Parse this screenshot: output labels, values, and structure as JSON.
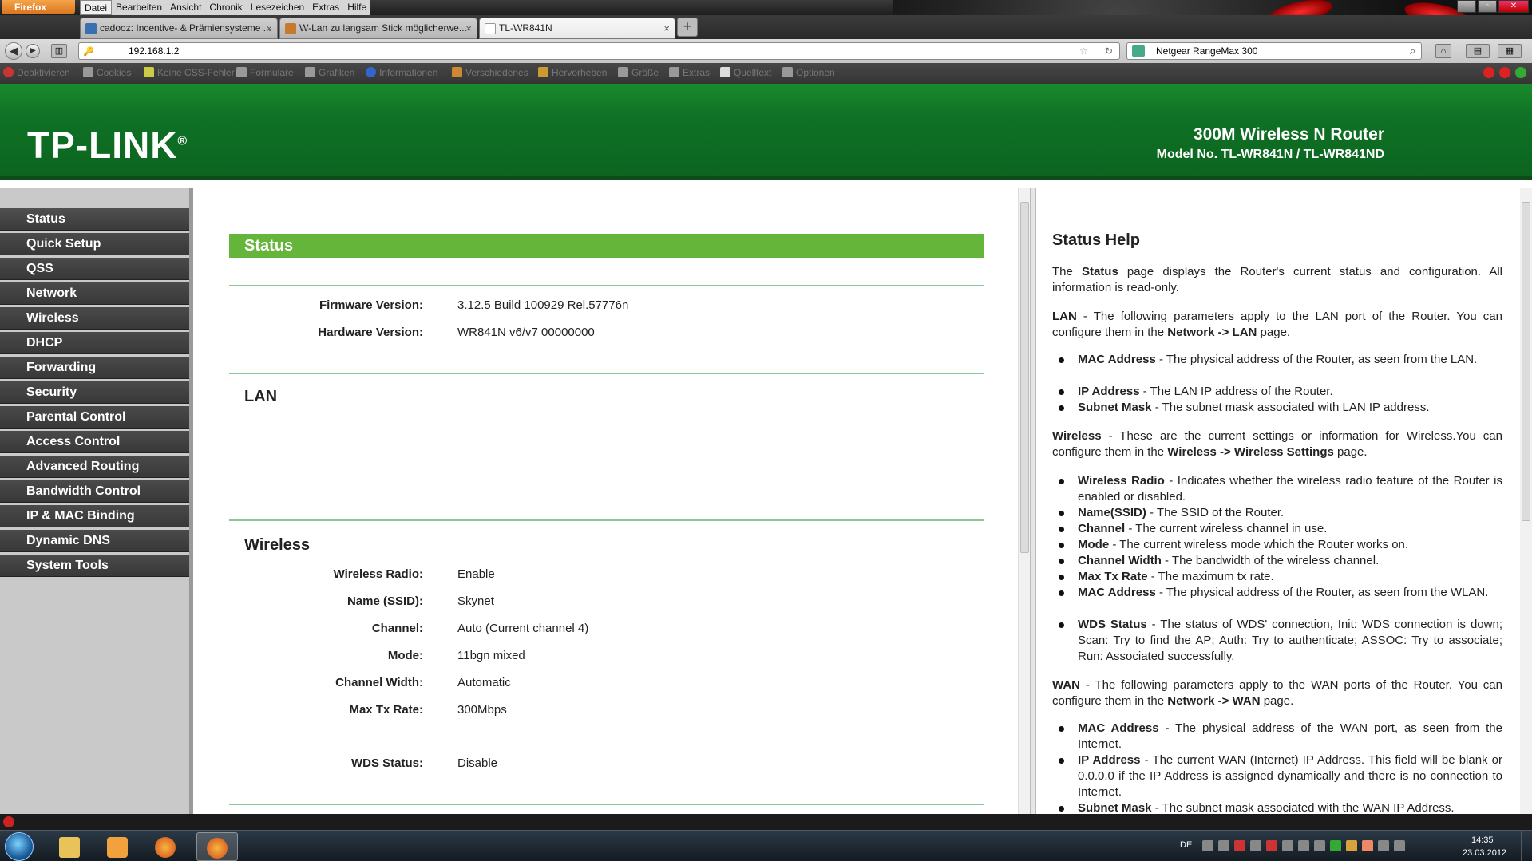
{
  "browser": {
    "app_button": "Firefox",
    "menu": [
      "Datei",
      "Bearbeiten",
      "Ansicht",
      "Chronik",
      "Lesezeichen",
      "Extras",
      "Hilfe"
    ],
    "tabs": [
      {
        "label": "cadooz: Incentive- & Prämiensysteme ...",
        "active": false
      },
      {
        "label": "W-Lan zu langsam Stick möglicherwe...",
        "active": false
      },
      {
        "label": "TL-WR841N",
        "active": true
      }
    ],
    "url": "192.168.1.2",
    "search_value": "Netgear RangeMax 300",
    "devbar": [
      "Deaktivieren",
      "Cookies",
      "Keine CSS-Fehler",
      "Formulare",
      "Grafiken",
      "Informationen",
      "Verschiedenes",
      "Hervorheben",
      "Größe",
      "Extras",
      "Quelltext",
      "Optionen"
    ]
  },
  "header": {
    "logo": "TP-LINK",
    "logo_mark": "®",
    "product": "300M Wireless N Router",
    "model": "Model No. TL-WR841N / TL-WR841ND"
  },
  "sidebar": {
    "items": [
      {
        "label": "Status"
      },
      {
        "label": "Quick Setup"
      },
      {
        "label": "QSS"
      },
      {
        "label": "Network"
      },
      {
        "label": "Wireless"
      },
      {
        "label": "DHCP"
      },
      {
        "label": "Forwarding"
      },
      {
        "label": "Security"
      },
      {
        "label": "Parental Control"
      },
      {
        "label": "Access Control"
      },
      {
        "label": "Advanced Routing"
      },
      {
        "label": "Bandwidth Control"
      },
      {
        "label": "IP & MAC Binding"
      },
      {
        "label": "Dynamic DNS"
      },
      {
        "label": "System Tools"
      }
    ]
  },
  "main": {
    "title": "Status",
    "firmware": {
      "label": "Firmware Version:",
      "value": "3.12.5 Build 100929 Rel.57776n"
    },
    "hardware": {
      "label": "Hardware Version:",
      "value": "WR841N v6/v7 00000000"
    },
    "lan_title": "LAN",
    "wireless_title": "Wireless",
    "wireless": [
      {
        "label": "Wireless Radio:",
        "value": "Enable"
      },
      {
        "label": "Name (SSID):",
        "value": "Skynet"
      },
      {
        "label": "Channel:",
        "value": "Auto (Current channel 4)"
      },
      {
        "label": "Mode:",
        "value": "11bgn mixed"
      },
      {
        "label": "Channel Width:",
        "value": "Automatic"
      },
      {
        "label": "Max Tx Rate:",
        "value": "300Mbps"
      },
      {
        "label": "WDS Status:",
        "value": "Disable"
      }
    ]
  },
  "help": {
    "title": "Status Help",
    "intro": [
      "The ",
      "Status",
      " page displays the Router's current status and configuration. All information is read-only."
    ],
    "lan": [
      "LAN",
      " - The following parameters apply to the LAN port of the Router. You can configure them in the ",
      "Network -> LAN",
      " page."
    ],
    "lan_items": [
      [
        "MAC Address",
        " - The physical address of the Router, as seen from the LAN."
      ],
      [
        "IP Address",
        " - The LAN IP address of the Router."
      ],
      [
        "Subnet Mask",
        " - The subnet mask associated with LAN IP address."
      ]
    ],
    "wireless": [
      "Wireless",
      " - These are the current settings or information for Wireless.You can configure them in the ",
      "Wireless -> Wireless Settings",
      " page."
    ],
    "wireless_items": [
      [
        "Wireless Radio",
        " - Indicates whether the wireless radio feature of the Router is enabled or disabled."
      ],
      [
        "Name(SSID)",
        " - The SSID of the Router."
      ],
      [
        "Channel",
        " - The current wireless channel in use."
      ],
      [
        "Mode",
        " - The current wireless mode which the Router works on."
      ],
      [
        "Channel Width",
        " - The bandwidth of the wireless channel."
      ],
      [
        "Max Tx Rate",
        " - The maximum tx rate."
      ],
      [
        "MAC Address",
        " - The physical address of the Router, as seen from the WLAN."
      ],
      [
        "WDS Status",
        " - The status of WDS' connection, Init: WDS connection is down; Scan: Try to find the AP; Auth: Try to authenticate; ASSOC: Try to associate; Run: Associated successfully."
      ]
    ],
    "wan": [
      "WAN",
      " - The following parameters apply to the WAN ports of the Router. You can configure them in the ",
      "Network -> WAN",
      " page."
    ],
    "wan_items": [
      [
        "MAC Address",
        " - The physical address of the WAN port, as seen from the Internet."
      ],
      [
        "IP Address",
        " - The current WAN (Internet) IP Address. This field will be blank or 0.0.0.0 if the IP Address is assigned dynamically and there is no connection to Internet."
      ],
      [
        "Subnet Mask",
        " - The subnet mask associated with the WAN IP Address."
      ]
    ]
  },
  "taskbar": {
    "lang": "DE",
    "time": "14:35",
    "date": "23.03.2012"
  }
}
